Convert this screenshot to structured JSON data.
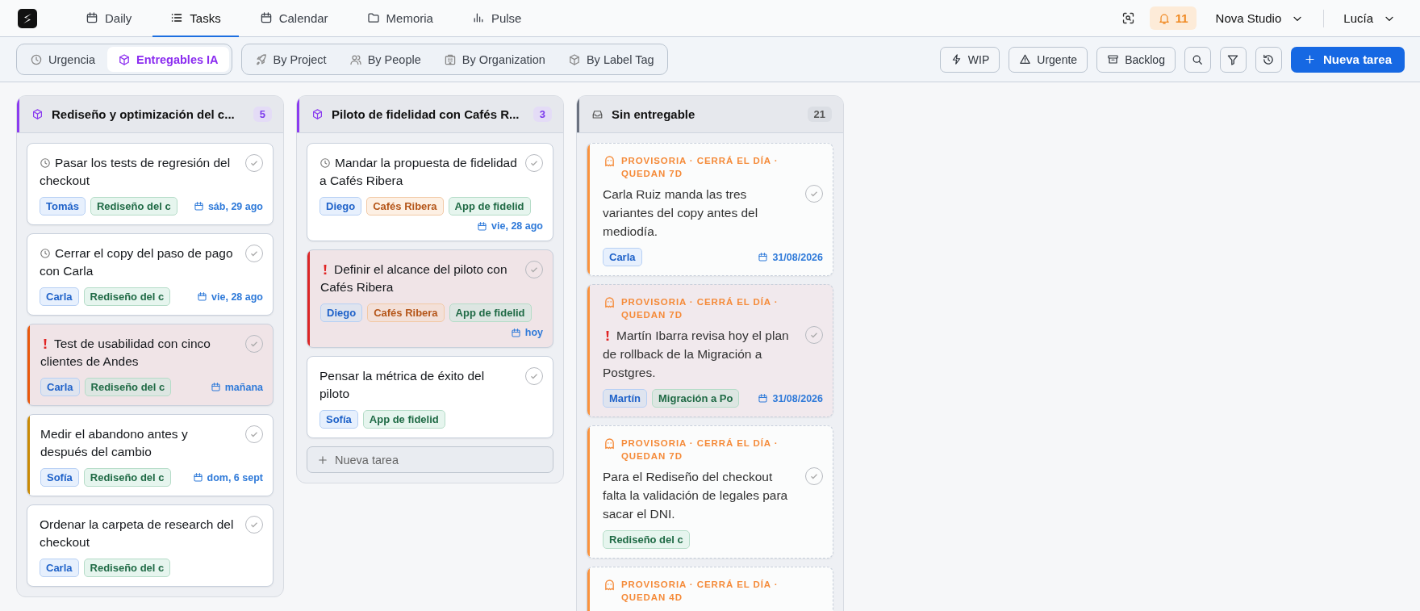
{
  "nav": {
    "tabs": [
      {
        "label": "Daily",
        "selected": false
      },
      {
        "label": "Tasks",
        "selected": true
      },
      {
        "label": "Calendar",
        "selected": false
      },
      {
        "label": "Memoria",
        "selected": false
      },
      {
        "label": "Pulse",
        "selected": false
      }
    ],
    "notifications": "11",
    "workspace": "Nova Studio",
    "user": "Lucía"
  },
  "toolbar": {
    "views": [
      {
        "label": "Urgencia",
        "selected": false
      },
      {
        "label": "Entregables IA",
        "selected": true
      }
    ],
    "groupings": [
      {
        "label": "By Project",
        "selected": false
      },
      {
        "label": "By People",
        "selected": false
      },
      {
        "label": "By Organization",
        "selected": false
      },
      {
        "label": "By Label Tag",
        "selected": false
      }
    ],
    "filters": [
      "WIP",
      "Urgente",
      "Backlog"
    ],
    "new_task": "Nueva tarea"
  },
  "columns": [
    {
      "kind": "deliverable",
      "title": "Rediseño y optimización del c...",
      "count": "5",
      "color": "#8b3cf0",
      "cards": [
        {
          "kind": "task",
          "timed": true,
          "urgent": false,
          "done": false,
          "title": "Pasar los tests de regresión del checkout",
          "tags": [
            {
              "text": "Tomás",
              "kind": "person"
            },
            {
              "text": "Rediseño del c",
              "kind": "project"
            }
          ],
          "date": "sáb, 29 ago"
        },
        {
          "kind": "task",
          "timed": true,
          "urgent": false,
          "done": false,
          "title": "Cerrar el copy del paso de pago con Carla",
          "tags": [
            {
              "text": "Carla",
              "kind": "person"
            },
            {
              "text": "Rediseño del c",
              "kind": "project"
            }
          ],
          "date": "vie, 28 ago"
        },
        {
          "kind": "task",
          "timed": false,
          "urgent": true,
          "done": false,
          "color": "#ea580c",
          "title": "Test de usabilidad con cinco clientes de Andes",
          "tags": [
            {
              "text": "Carla",
              "kind": "person"
            },
            {
              "text": "Rediseño del c",
              "kind": "project"
            }
          ],
          "date": "mañana"
        },
        {
          "kind": "task",
          "timed": false,
          "urgent": false,
          "done": false,
          "color": "#ca8a04",
          "title": "Medir el abandono antes y después del cambio",
          "tags": [
            {
              "text": "Sofía",
              "kind": "person"
            },
            {
              "text": "Rediseño del c",
              "kind": "project"
            }
          ],
          "date": "dom, 6 sept"
        },
        {
          "kind": "task",
          "timed": false,
          "urgent": false,
          "done": false,
          "title": "Ordenar la carpeta de research del checkout",
          "tags": [
            {
              "text": "Carla",
              "kind": "person"
            },
            {
              "text": "Rediseño del c",
              "kind": "project"
            }
          ]
        }
      ]
    },
    {
      "kind": "deliverable",
      "title": "Piloto de fidelidad con Cafés R...",
      "count": "3",
      "color": "#8b3cf0",
      "add_label": "Nueva tarea",
      "cards": [
        {
          "kind": "task",
          "timed": true,
          "urgent": false,
          "done": false,
          "title": "Mandar la propuesta de fidelidad a Cafés Ribera",
          "tags": [
            {
              "text": "Diego",
              "kind": "person"
            },
            {
              "text": "Cafés Ribera",
              "kind": "org"
            },
            {
              "text": "App de fidelid",
              "kind": "project"
            }
          ],
          "date": "vie, 28 ago"
        },
        {
          "kind": "task",
          "timed": false,
          "urgent": true,
          "done": false,
          "color": "#dc2626",
          "title": "Definir el alcance del piloto con Cafés Ribera",
          "tags": [
            {
              "text": "Diego",
              "kind": "person"
            },
            {
              "text": "Cafés Ribera",
              "kind": "org"
            },
            {
              "text": "App de fidelid",
              "kind": "project"
            }
          ],
          "date": "hoy"
        },
        {
          "kind": "task",
          "timed": false,
          "urgent": false,
          "done": false,
          "title": "Pensar la métrica de éxito del piloto",
          "tags": [
            {
              "text": "Sofía",
              "kind": "person"
            },
            {
              "text": "App de fidelid",
              "kind": "project"
            }
          ]
        }
      ]
    },
    {
      "kind": "unassigned",
      "title": "Sin entregable",
      "count": "21",
      "color": "#6b7280",
      "cards": [
        {
          "kind": "provisional",
          "note": "PROVISORIA · CERRÁ EL DÍA · QUEDAN 7D",
          "timed": false,
          "urgent": false,
          "done": false,
          "color": "#fb923c",
          "title": "Carla Ruiz manda las tres variantes del copy antes del mediodía.",
          "tags": [
            {
              "text": "Carla",
              "kind": "person"
            }
          ],
          "date": "31/08/2026"
        },
        {
          "kind": "provisional",
          "note": "PROVISORIA · CERRÁ EL DÍA · QUEDAN 7D",
          "timed": false,
          "urgent": true,
          "done": false,
          "color": "#fb923c",
          "title": "Martín Ibarra revisa hoy el plan de rollback de la Migración a Postgres.",
          "tags": [
            {
              "text": "Martín",
              "kind": "person"
            },
            {
              "text": "Migración a Po",
              "kind": "project"
            }
          ],
          "date": "31/08/2026"
        },
        {
          "kind": "provisional",
          "note": "PROVISORIA · CERRÁ EL DÍA · QUEDAN 7D",
          "timed": false,
          "urgent": false,
          "done": false,
          "color": "#fb923c",
          "title": "Para el Rediseño del checkout falta la validación de legales para sacar el DNI.",
          "tags": [
            {
              "text": "Rediseño del c",
              "kind": "project"
            }
          ]
        },
        {
          "kind": "provisional",
          "note": "PROVISORIA · CERRÁ EL DÍA · QUEDAN 4D",
          "color": "#fb923c"
        }
      ]
    }
  ]
}
